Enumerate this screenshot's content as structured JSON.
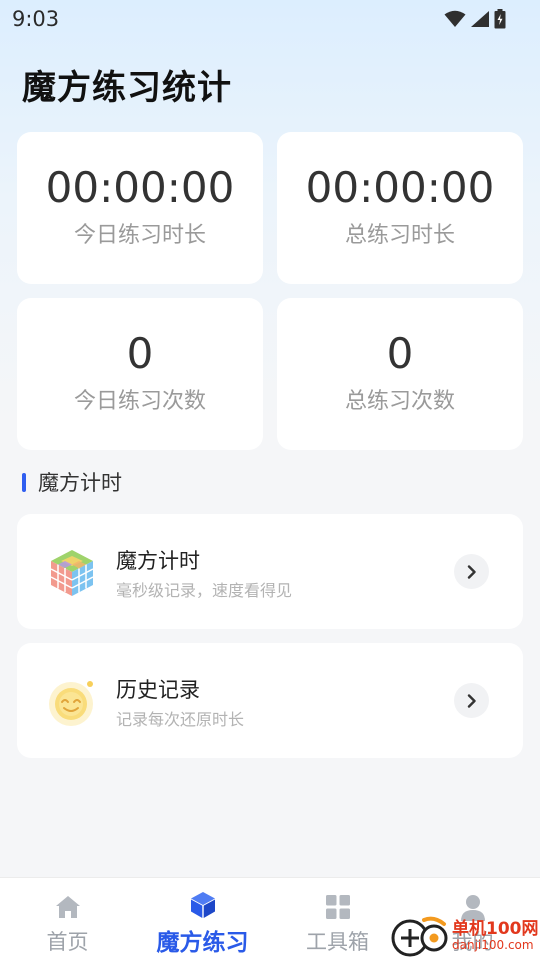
{
  "status_bar": {
    "time": "9:03"
  },
  "page": {
    "title": "魔方练习统计"
  },
  "stats": [
    {
      "value": "00:00:00",
      "label": "今日练习时长"
    },
    {
      "value": "00:00:00",
      "label": "总练习时长"
    },
    {
      "value": "0",
      "label": "今日练习次数"
    },
    {
      "value": "0",
      "label": "总练习次数"
    }
  ],
  "section": {
    "title": "魔方计时"
  },
  "features": [
    {
      "title": "魔方计时",
      "subtitle": "毫秒级记录，速度看得见",
      "icon": "rubiks-cube-icon"
    },
    {
      "title": "历史记录",
      "subtitle": "记录每次还原时长",
      "icon": "smiley-sun-icon"
    }
  ],
  "tabs": [
    {
      "label": "首页",
      "icon": "home-icon",
      "active": false
    },
    {
      "label": "魔方练习",
      "icon": "cube-icon",
      "active": true
    },
    {
      "label": "工具箱",
      "icon": "grid-icon",
      "active": false
    },
    {
      "label": "我的",
      "icon": "user-icon",
      "active": false
    }
  ],
  "watermark": {
    "name": "单机100网",
    "url": "danji100.com"
  },
  "colors": {
    "accent": "#2a5ae8",
    "section_bar": "#2f5ef0",
    "inactive_tab": "#9ea3aa",
    "watermark": "#e2381d"
  }
}
